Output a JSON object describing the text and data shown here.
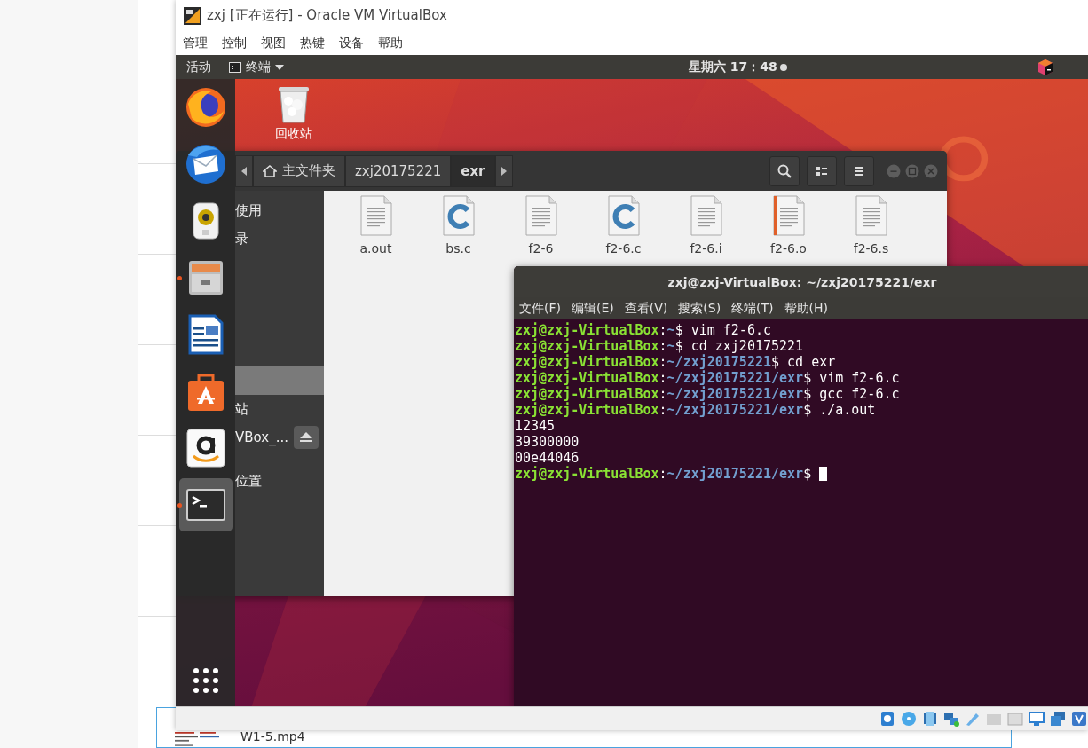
{
  "host_page": {
    "file_name": "W1-5.mp4"
  },
  "vbox_window": {
    "title": "zxj [正在运行] - Oracle VM VirtualBox",
    "menu": [
      "管理",
      "控制",
      "视图",
      "热键",
      "设备",
      "帮助"
    ]
  },
  "top_bar": {
    "activities": "活动",
    "app_menu": "终端",
    "clock": "星期六 17：48"
  },
  "dock": {
    "items": [
      {
        "kind": "browser",
        "running": false,
        "selected": false
      },
      {
        "kind": "mail",
        "running": false,
        "selected": false
      },
      {
        "kind": "music",
        "running": false,
        "selected": false
      },
      {
        "kind": "files",
        "running": true,
        "selected": false
      },
      {
        "kind": "writer",
        "running": false,
        "selected": false
      },
      {
        "kind": "store",
        "running": false,
        "selected": false
      },
      {
        "kind": "shop",
        "running": false,
        "selected": false
      },
      {
        "kind": "terminal",
        "running": true,
        "selected": true
      }
    ]
  },
  "desktop": {
    "trash_label": "回收站"
  },
  "file_manager": {
    "path": [
      {
        "label": "主文件夹",
        "home": true,
        "selected": false
      },
      {
        "label": "zxj20175221",
        "home": false,
        "selected": false
      },
      {
        "label": "exr",
        "home": false,
        "selected": true
      }
    ],
    "sidebar": [
      {
        "label": "使用",
        "eject": false,
        "selected": false
      },
      {
        "label": "录",
        "eject": false,
        "selected": false
      },
      {
        "eject": false,
        "selected": true
      },
      {
        "label": "站",
        "eject": false,
        "selected": false
      },
      {
        "label": "VBox_...",
        "eject": true,
        "selected": false
      },
      {
        "label": "位置",
        "eject": false,
        "selected": false
      }
    ],
    "files": [
      {
        "name": "a.out",
        "kind": "text"
      },
      {
        "name": "bs.c",
        "kind": "c"
      },
      {
        "name": "f2-6",
        "kind": "text"
      },
      {
        "name": "f2-6.c",
        "kind": "c"
      },
      {
        "name": "f2-6.i",
        "kind": "text"
      },
      {
        "name": "f2-6.o",
        "kind": "object"
      },
      {
        "name": "f2-6.s",
        "kind": "text"
      }
    ]
  },
  "terminal": {
    "title": "zxj@zxj-VirtualBox: ~/zxj20175221/exr",
    "menu": [
      "文件(F)",
      "编辑(E)",
      "查看(V)",
      "搜索(S)",
      "终端(T)",
      "帮助(H)"
    ],
    "lines": [
      {
        "kind": "prompt",
        "user": "zxj@zxj-VirtualBox",
        "sep": ":",
        "path": "~",
        "command": "$ vim f2-6.c",
        "cursor": false
      },
      {
        "kind": "prompt",
        "user": "zxj@zxj-VirtualBox",
        "sep": ":",
        "path": "~",
        "command": "$ cd zxj20175221",
        "cursor": false
      },
      {
        "kind": "prompt",
        "user": "zxj@zxj-VirtualBox",
        "sep": ":",
        "path": "~/zxj20175221",
        "command": "$ cd exr",
        "cursor": false
      },
      {
        "kind": "prompt",
        "user": "zxj@zxj-VirtualBox",
        "sep": ":",
        "path": "~/zxj20175221/exr",
        "command": "$ vim f2-6.c",
        "cursor": false
      },
      {
        "kind": "prompt",
        "user": "zxj@zxj-VirtualBox",
        "sep": ":",
        "path": "~/zxj20175221/exr",
        "command": "$ gcc f2-6.c",
        "cursor": false
      },
      {
        "kind": "prompt",
        "user": "zxj@zxj-VirtualBox",
        "sep": ":",
        "path": "~/zxj20175221/exr",
        "command": "$ ./a.out",
        "cursor": false
      },
      {
        "kind": "output",
        "text": "12345"
      },
      {
        "kind": "output",
        "text": "39300000"
      },
      {
        "kind": "output",
        "text": "00e44046"
      },
      {
        "kind": "prompt",
        "user": "zxj@zxj-VirtualBox",
        "sep": ":",
        "path": "~/zxj20175221/exr",
        "command": "$",
        "cursor": true
      }
    ]
  }
}
